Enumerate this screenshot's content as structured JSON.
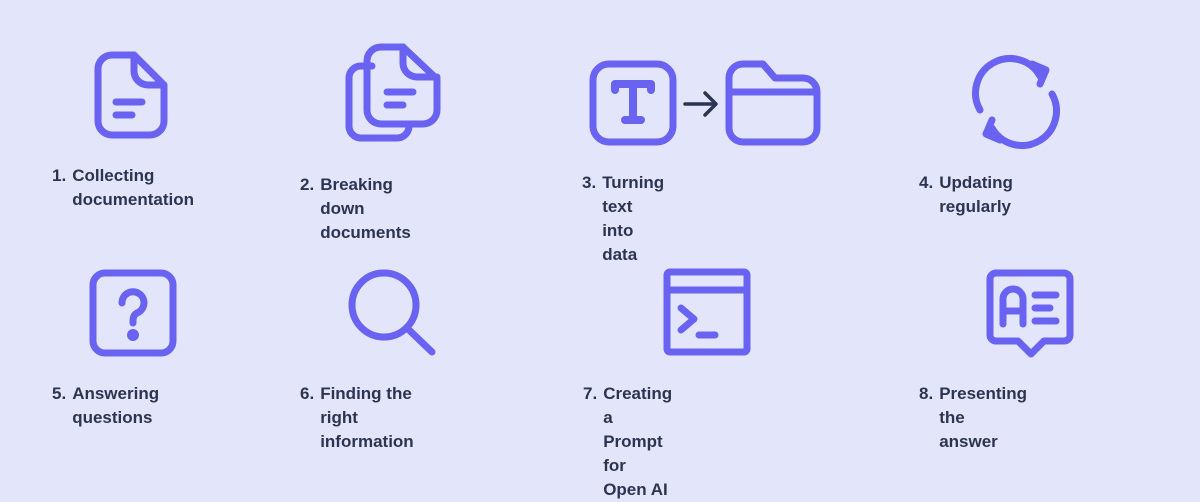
{
  "colors": {
    "background": "#e3e6fa",
    "icon_stroke": "#6a62f0",
    "text": "#2b3551",
    "arrow": "#2b3551"
  },
  "steps": [
    {
      "number": "1.",
      "line1": "Collecting",
      "line2": "documentation",
      "icon": "document-icon"
    },
    {
      "number": "2.",
      "line1": "Breaking down",
      "line2": "documents",
      "icon": "documents-stack-icon"
    },
    {
      "number": "3.",
      "line1": "Turning text into data",
      "line2": "",
      "icon": "text-to-folder-icon"
    },
    {
      "number": "4.",
      "line1": "Updating regularly",
      "line2": "",
      "icon": "refresh-icon"
    },
    {
      "number": "5.",
      "line1": "Answering",
      "line2": "questions",
      "icon": "question-icon"
    },
    {
      "number": "6.",
      "line1": "Finding the right",
      "line2": "information",
      "icon": "search-icon"
    },
    {
      "number": "7.",
      "line1": "Creating a Prompt for",
      "line2": "Open AI",
      "icon": "terminal-icon"
    },
    {
      "number": "8.",
      "line1": "Presenting the answer",
      "line2": "",
      "icon": "answer-bubble-icon"
    }
  ]
}
